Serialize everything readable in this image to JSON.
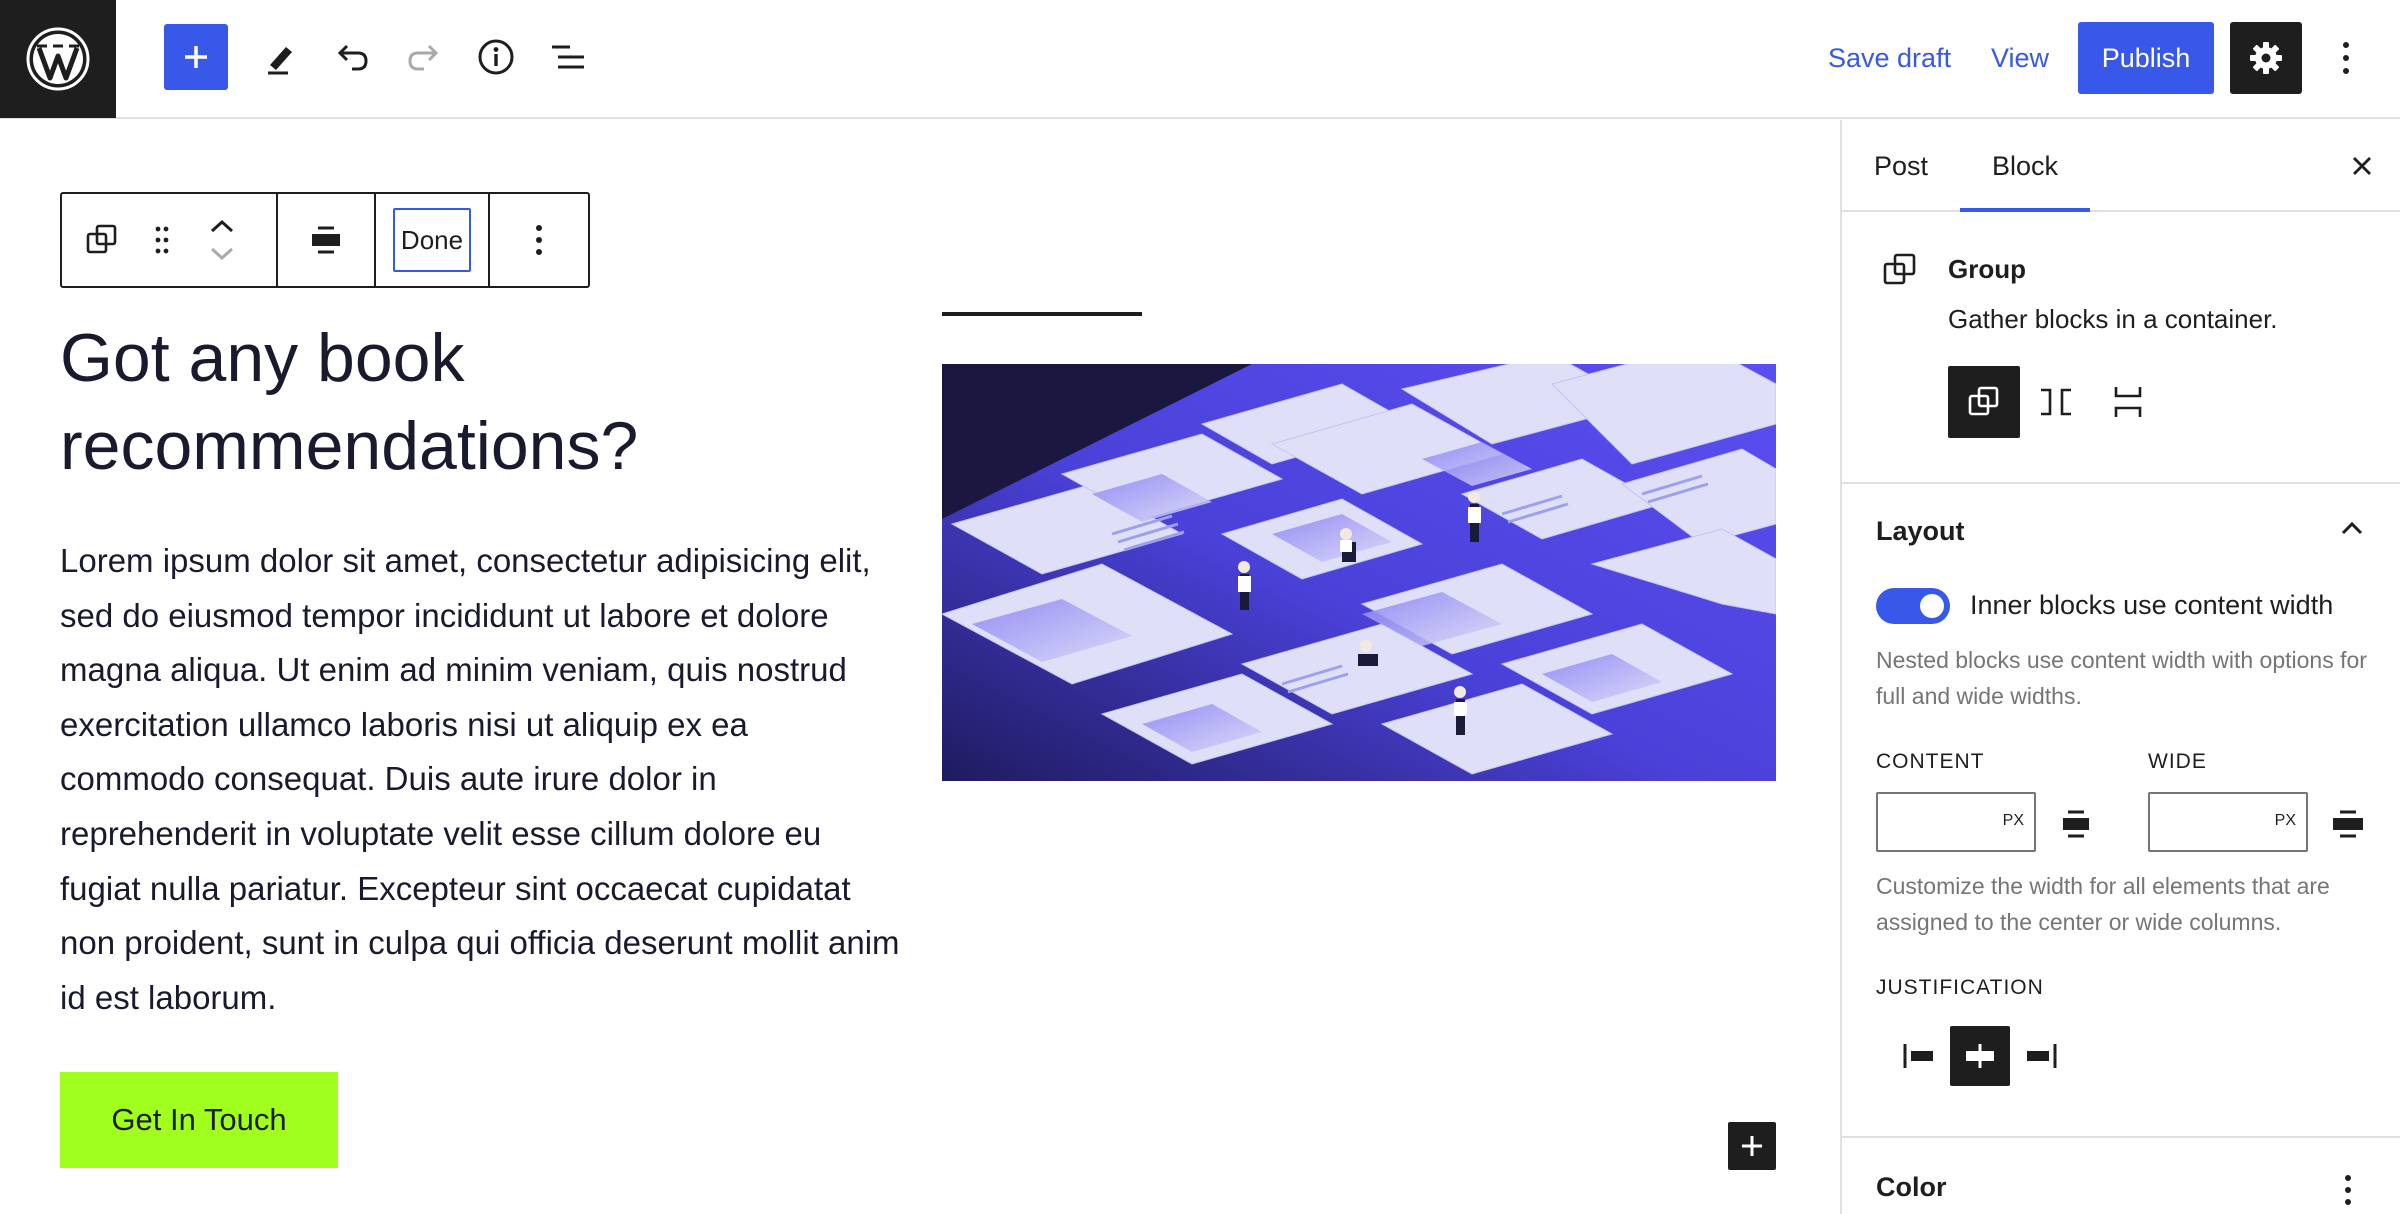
{
  "header": {
    "save_draft": "Save draft",
    "view": "View",
    "publish": "Publish",
    "icons": [
      "wordpress-logo",
      "plus-icon",
      "pencil-icon",
      "undo-icon",
      "redo-icon",
      "info-icon",
      "list-view-icon",
      "gear-icon",
      "more-vertical-icon"
    ]
  },
  "block_toolbar": {
    "done": "Done",
    "icons": [
      "group-icon",
      "drag-handle-icon",
      "chevron-up-icon",
      "chevron-down-icon",
      "align-center-icon",
      "more-vertical-icon"
    ]
  },
  "content": {
    "heading": "Got any book recommendations?",
    "paragraph": "Lorem ipsum dolor sit amet, consectetur adipisicing elit, sed do eiusmod tempor incididunt ut labore et dolore magna aliqua. Ut enim ad minim veniam, quis nostrud exercitation ullamco laboris nisi ut aliquip ex ea commodo consequat. Duis aute irure dolor in reprehenderit in voluptate velit esse cillum dolore eu fugiat nulla pariatur. Excepteur sint occaecat cupidatat non proident, sunt in culpa qui officia deserunt mollit anim id est laborum.",
    "cta": "Get In Touch"
  },
  "sidebar": {
    "tabs": {
      "post": "Post",
      "block": "Block"
    },
    "block_card": {
      "title": "Group",
      "description": "Gather blocks in a container."
    },
    "layout": {
      "title": "Layout",
      "toggle_label": "Inner blocks use content width",
      "toggle_on": true,
      "toggle_help": "Nested blocks use content width with options for full and wide widths.",
      "content_label": "CONTENT",
      "wide_label": "WIDE",
      "unit": "PX",
      "width_help": "Customize the width for all elements that are assigned to the center or wide columns.",
      "justification_label": "JUSTIFICATION"
    },
    "color": {
      "title": "Color"
    }
  },
  "colors": {
    "accent": "#3858e9",
    "dark": "#1e1e1e",
    "cta": "#a0ff1f",
    "muted": "#757575",
    "border": "#e0e0e0"
  }
}
